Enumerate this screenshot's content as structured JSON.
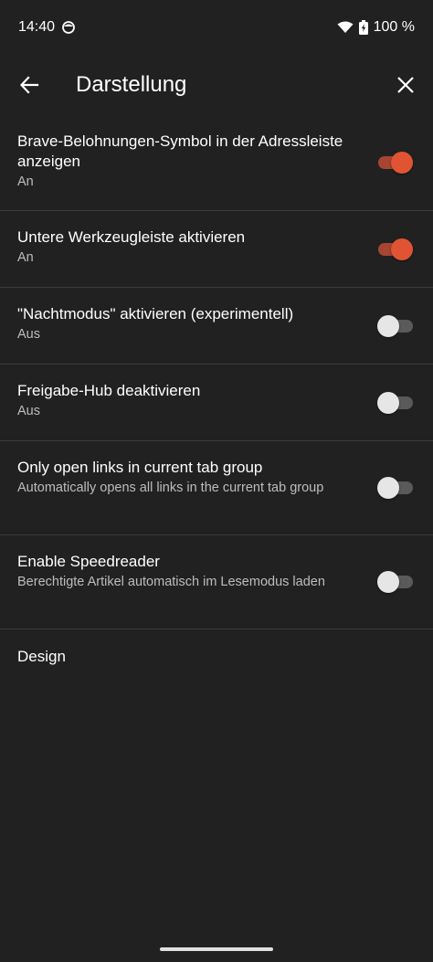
{
  "status_bar": {
    "time": "14:40",
    "battery": "100 %",
    "icons": [
      "face-icon",
      "wifi-icon",
      "battery-charging-icon"
    ]
  },
  "app_bar": {
    "title": "Darstellung",
    "back_icon": "arrow-left-icon",
    "close_icon": "close-icon"
  },
  "colors": {
    "background": "#212121",
    "accent": "#e05434",
    "divider": "#3c3c3c"
  },
  "settings": [
    {
      "title": "Brave-Belohnungen-Symbol in der Adressleiste anzeigen",
      "subtitle": "An",
      "enabled": true
    },
    {
      "title": "Untere Werkzeugleiste aktivieren",
      "subtitle": "An",
      "enabled": true
    },
    {
      "title": "\"Nachtmodus\" aktivieren (experimentell)",
      "subtitle": "Aus",
      "enabled": false
    },
    {
      "title": "Freigabe-Hub deaktivieren",
      "subtitle": "Aus",
      "enabled": false
    },
    {
      "title": "Only open links in current tab group",
      "subtitle": "Automatically opens all links in the current tab group",
      "enabled": false
    },
    {
      "title": "Enable Speedreader",
      "subtitle": "Berechtigte Artikel automatisch im Lesemodus laden",
      "enabled": false
    }
  ],
  "section": {
    "design_label": "Design"
  }
}
